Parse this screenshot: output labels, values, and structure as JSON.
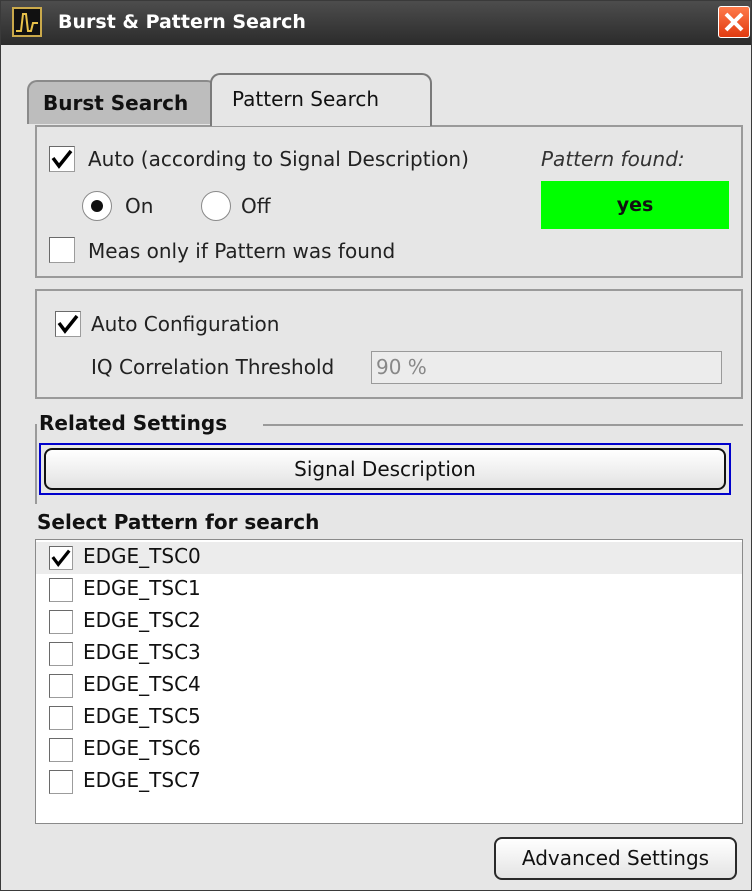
{
  "window": {
    "title": "Burst & Pattern Search",
    "icon": "signal-burst-icon",
    "close_icon": "close-icon"
  },
  "tabs": [
    {
      "label": "Burst Search",
      "active": false
    },
    {
      "label": "Pattern Search",
      "active": true
    }
  ],
  "auto": {
    "checkbox_label": "Auto (according to Signal Description)",
    "checked": true,
    "radio_on_label": "On",
    "radio_off_label": "Off",
    "selected": "On",
    "pattern_found_label": "Pattern found:",
    "pattern_found_value": "yes",
    "meas_only_label": "Meas only if Pattern was found",
    "meas_only_checked": false
  },
  "config": {
    "auto_configuration_label": "Auto Configuration",
    "auto_configuration_checked": true,
    "threshold_label": "IQ Correlation Threshold",
    "threshold_value": "90 %"
  },
  "related": {
    "heading": "Related Settings",
    "button_label": "Signal Description"
  },
  "patterns": {
    "heading": "Select Pattern for search",
    "items": [
      {
        "label": "EDGE_TSC0",
        "checked": true
      },
      {
        "label": "EDGE_TSC1",
        "checked": false
      },
      {
        "label": "EDGE_TSC2",
        "checked": false
      },
      {
        "label": "EDGE_TSC3",
        "checked": false
      },
      {
        "label": "EDGE_TSC4",
        "checked": false
      },
      {
        "label": "EDGE_TSC5",
        "checked": false
      },
      {
        "label": "EDGE_TSC6",
        "checked": false
      },
      {
        "label": "EDGE_TSC7",
        "checked": false
      }
    ]
  },
  "footer": {
    "advanced_label": "Advanced Settings"
  },
  "colors": {
    "found_indicator": "#00ff00",
    "focus_border": "#0000cc",
    "title_bar": "#2b2b2b"
  }
}
